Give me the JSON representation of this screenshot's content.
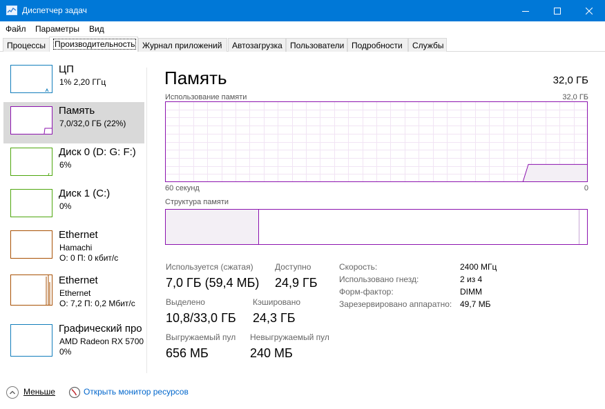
{
  "window": {
    "title": "Диспетчер задач"
  },
  "menu": [
    "Файл",
    "Параметры",
    "Вид"
  ],
  "tabs": [
    "Процессы",
    "Производительность",
    "Журнал приложений",
    "Автозагрузка",
    "Пользователи",
    "Подробности",
    "Службы"
  ],
  "active_tab": "Производительность",
  "sidebar": [
    {
      "name": "ЦП",
      "sub1": "1% 2,20 ГГц",
      "sub2": "",
      "color": "#117dbb",
      "selected": false
    },
    {
      "name": "Память",
      "sub1": "7,0/32,0 ГБ (22%)",
      "sub2": "",
      "color": "#8b12ae",
      "selected": true
    },
    {
      "name": "Диск 0 (D: G: F:)",
      "sub1": "6%",
      "sub2": "",
      "color": "#4da60c",
      "selected": false
    },
    {
      "name": "Диск 1 (C:)",
      "sub1": "0%",
      "sub2": "",
      "color": "#4da60c",
      "selected": false
    },
    {
      "name": "Ethernet",
      "sub1": "Hamachi",
      "sub2": "О: 0 П: 0 кбит/с",
      "color": "#a74f01",
      "selected": false
    },
    {
      "name": "Ethernet",
      "sub1": "Ethernet",
      "sub2": "О: 7,2 П: 0,2 Мбит/с",
      "color": "#a74f01",
      "selected": false
    },
    {
      "name": "Графический про",
      "sub1": "AMD Radeon RX 5700",
      "sub2": "0%",
      "color": "#117dbb",
      "selected": false
    }
  ],
  "main": {
    "title": "Память",
    "total": "32,0 ГБ",
    "usage_chart": {
      "label": "Использование памяти",
      "max_label": "32,0 ГБ",
      "x_left_label": "60 секунд",
      "x_right_label": "0",
      "max_value_gb": 32.0,
      "current_value_gb": 7.0,
      "color": "#8b12ae"
    },
    "structure_label": "Структура памяти",
    "stats": {
      "in_use_label": "Используется (сжатая)",
      "in_use_value": "7,0 ГБ (59,4 МБ)",
      "available_label": "Доступно",
      "available_value": "24,9 ГБ",
      "committed_label": "Выделено",
      "committed_value": "10,8/33,0 ГБ",
      "cached_label": "Кэшировано",
      "cached_value": "24,3 ГБ",
      "paged_label": "Выгружаемый пул",
      "paged_value": "656 МБ",
      "nonpaged_label": "Невыгружаемый пул",
      "nonpaged_value": "240 МБ"
    },
    "details": [
      {
        "label": "Скорость:",
        "value": "2400 МГц"
      },
      {
        "label": "Использовано гнезд:",
        "value": "2 из 4"
      },
      {
        "label": "Форм-фактор:",
        "value": "DIMM"
      },
      {
        "label": "Зарезервировано аппаратно:",
        "value": "49,7 МБ"
      }
    ]
  },
  "footer": {
    "less_label": "Меньше",
    "monitor_link": "Открыть монитор ресурсов"
  }
}
